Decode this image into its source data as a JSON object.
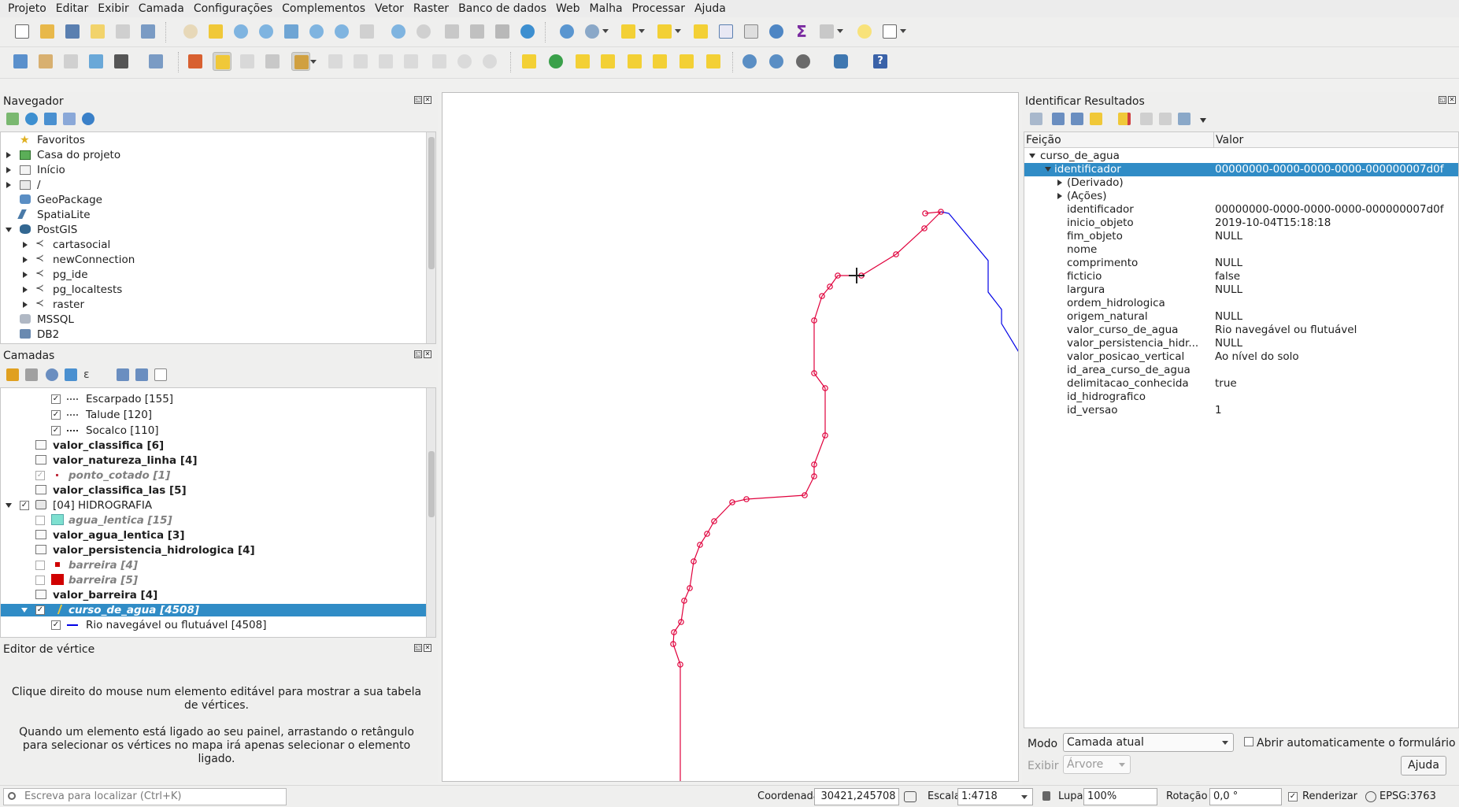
{
  "menubar": [
    "Projeto",
    "Editar",
    "Exibir",
    "Camada",
    "Configurações",
    "Complementos",
    "Vetor",
    "Raster",
    "Banco de dados",
    "Web",
    "Malha",
    "Processar",
    "Ajuda"
  ],
  "browser": {
    "title": "Navegador",
    "items": [
      "Favoritos",
      "Casa do projeto",
      "Início",
      "/",
      "GeoPackage",
      "SpatiaLite",
      "PostGIS",
      "cartasocial",
      "newConnection",
      "pg_ide",
      "pg_localtests",
      "raster",
      "MSSQL",
      "DB2"
    ]
  },
  "layers": {
    "title": "Camadas",
    "items": [
      "Escarpado [155]",
      "Talude [120]",
      "Socalco [110]",
      "valor_classifica [6]",
      "valor_natureza_linha [4]",
      "ponto_cotado [1]",
      "valor_classifica_las [5]",
      "[04] HIDROGRAFIA",
      "agua_lentica [15]",
      "valor_agua_lentica [3]",
      "valor_persistencia_hidrologica [4]",
      "barreira [4]",
      "barreira [5]",
      "valor_barreira [4]",
      "curso_de_agua [4508]",
      "Rio navegável ou flutuável [4508]"
    ]
  },
  "vertex_editor": {
    "title": "Editor de vértice",
    "message1": "Clique direito do mouse num elemento editável para mostrar a sua tabela de vértices.",
    "message2": "Quando um elemento está ligado ao seu painel, arrastando o retângulo para selecionar os vértices no mapa irá apenas selecionar o elemento ligado."
  },
  "identify": {
    "title": "Identificar Resultados",
    "col_feature": "Feição",
    "col_value": "Valor",
    "layer": "curso_de_agua",
    "feature_key": "identificador",
    "feature_val": "00000000-0000-0000-0000-000000007d0f",
    "derived": "(Derivado)",
    "actions": "(Ações)",
    "attributes": [
      {
        "k": "identificador",
        "v": "00000000-0000-0000-0000-000000007d0f"
      },
      {
        "k": "inicio_objeto",
        "v": "2019-10-04T15:18:18"
      },
      {
        "k": "fim_objeto",
        "v": "NULL"
      },
      {
        "k": "nome",
        "v": ""
      },
      {
        "k": "comprimento",
        "v": "NULL"
      },
      {
        "k": "ficticio",
        "v": "false"
      },
      {
        "k": "largura",
        "v": "NULL"
      },
      {
        "k": "ordem_hidrologica",
        "v": ""
      },
      {
        "k": "origem_natural",
        "v": "NULL"
      },
      {
        "k": "valor_curso_de_agua",
        "v": "Rio navegável ou flutuável"
      },
      {
        "k": "valor_persistencia_hidr...",
        "v": "NULL"
      },
      {
        "k": "valor_posicao_vertical",
        "v": "Ao nível do solo"
      },
      {
        "k": "id_area_curso_de_agua",
        "v": ""
      },
      {
        "k": "delimitacao_conhecida",
        "v": "true"
      },
      {
        "k": "id_hidrografico",
        "v": ""
      },
      {
        "k": "id_versao",
        "v": "1"
      }
    ],
    "mode_label": "Modo",
    "mode_value": "Camada atual",
    "auto_open_label": "Abrir automaticamente o formulário",
    "view_label": "Exibir",
    "view_value": "Árvore",
    "help_label": "Ajuda"
  },
  "statusbar": {
    "locator_placeholder": "Escreva para localizar (Ctrl+K)",
    "coord_label": "Coordenada",
    "coord_value": "30421,245708",
    "scale_label": "Escala",
    "scale_value": "1:4718",
    "magnifier_label": "Lupa",
    "magnifier_value": "100%",
    "rotation_label": "Rotação",
    "rotation_value": "0,0 °",
    "render_label": "Renderizar",
    "crs": "EPSG:3763"
  },
  "colors": {
    "selection": "#308cc6",
    "feature_line": "#e0003c",
    "river": "#0000e6"
  }
}
